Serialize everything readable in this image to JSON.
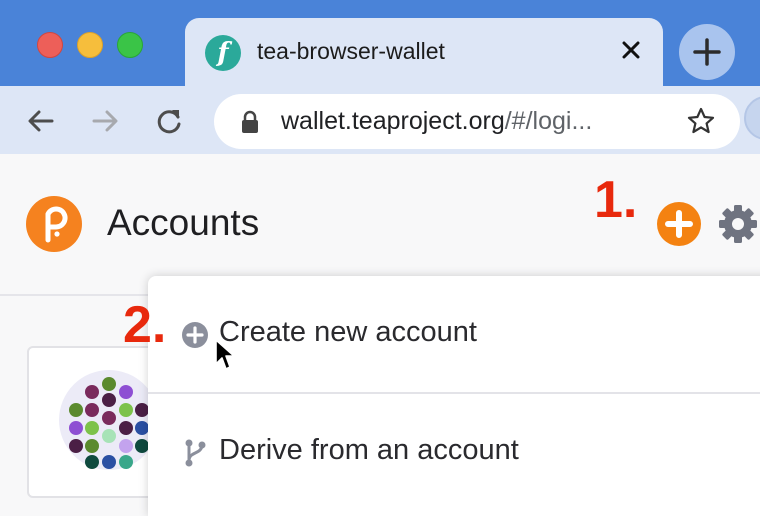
{
  "browser": {
    "tab": {
      "favicon_letter": "f",
      "title": "tea-browser-wallet",
      "close_icon": "close-icon"
    },
    "new_tab_icon": "plus-icon",
    "nav": {
      "back_icon": "arrow-left-icon",
      "forward_icon": "arrow-right-icon",
      "reload_icon": "reload-icon"
    },
    "address_bar": {
      "url_host": "wallet.teaproject.org",
      "url_rest": "/#/logi...",
      "lock_icon": "lock-icon",
      "bookmark_icon": "star-icon"
    }
  },
  "page": {
    "logo_icon": "polkadot-logo-icon",
    "title": "Accounts",
    "add_account_icon": "plus-circle-icon",
    "settings_icon": "gear-icon",
    "annotations": {
      "step1": "1.",
      "step2": "2."
    },
    "account_card": {
      "identicon": "identicon"
    },
    "menu": {
      "items": [
        {
          "label": "Create new account",
          "icon": "plus-circle-icon"
        },
        {
          "label": "Derive from an account",
          "icon": "branch-icon"
        }
      ]
    }
  },
  "colors": {
    "titlebar": "#4a83d8",
    "tab_bg": "#dde6f6",
    "accent_orange": "#f48211",
    "annotation_red": "#e8290d",
    "page_bg": "#f8f8f9"
  }
}
